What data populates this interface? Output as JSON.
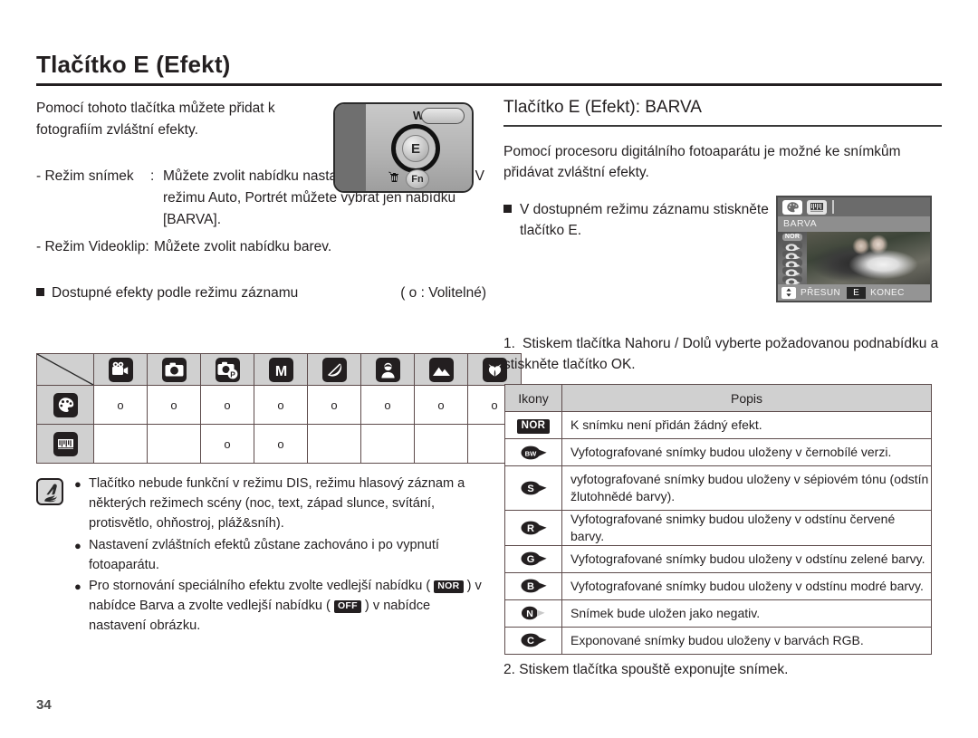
{
  "page": {
    "number": "34",
    "main_title": "Tlačítko E (Efekt)"
  },
  "left": {
    "lead": "Pomocí tohoto tlačítka můžete přidat k fotografiím zvláštní efekty.",
    "modes": [
      {
        "label": "- Režim snímek",
        "colon": ":",
        "desc": "Můžete zvolit nabídku nastavení barvy a obrázku. V režimu Auto, Portrét můžete vybrat jen nabídku [BARVA]."
      },
      {
        "label": "- Režim Videoklip:",
        "colon": "",
        "desc": "Můžete zvolit nabídku barev."
      }
    ],
    "available_heading": "Dostupné efekty podle režimu záznamu",
    "available_note": "( o : Volitelné)",
    "camera_illustration": {
      "w_label": "W",
      "e_button": "E",
      "fn_button": "Fn",
      "trash_icon": "trash-icon"
    }
  },
  "matrix": {
    "columns": [
      {
        "icon": "movie-clip-icon"
      },
      {
        "icon": "auto-mode-icon"
      },
      {
        "icon": "program-mode-icon"
      },
      {
        "icon": "manual-mode-icon"
      },
      {
        "icon": "scene-mode-icon"
      },
      {
        "icon": "portrait-mode-icon"
      },
      {
        "icon": "landscape-mode-icon"
      },
      {
        "icon": "macro-mode-icon"
      }
    ],
    "rows": [
      {
        "icon": "color-palette-icon",
        "values": [
          "o",
          "o",
          "o",
          "o",
          "o",
          "o",
          "o",
          "o"
        ]
      },
      {
        "icon": "image-adjust-icon",
        "values": [
          "",
          "",
          "o",
          "o",
          "",
          "",
          "",
          ""
        ]
      }
    ]
  },
  "note": {
    "icon": "note-hand-icon",
    "items": [
      {
        "bullet": "●",
        "parts": [
          {
            "type": "text",
            "value": "Tlačítko nebude funkční v režimu DIS, režimu hlasový záznam a některých režimech scény (noc, text, západ slunce, svítání, protisvětlo, ohňostroj, pláž&sníh)."
          }
        ]
      },
      {
        "bullet": "●",
        "parts": [
          {
            "type": "text",
            "value": "Nastavení zvláštních efektů zůstane zachováno i po vypnutí fotoaparátu."
          }
        ]
      },
      {
        "bullet": "●",
        "parts": [
          {
            "type": "text",
            "value": "Pro stornování speciálního efektu zvolte vedlejší nabídku ( "
          },
          {
            "type": "badge",
            "value": "NOR"
          },
          {
            "type": "text",
            "value": " ) v nabídce Barva a zvolte vedlejší nabídku ( "
          },
          {
            "type": "badge",
            "value": "OFF"
          },
          {
            "type": "text",
            "value": " ) v nabídce nastavení obrázku."
          }
        ]
      }
    ]
  },
  "right": {
    "sub_title": "Tlačítko E (Efekt): BARVA",
    "lead": "Pomocí procesoru digitálního fotoaparátu je možné ke snímkům přidávat zvláštní efekty.",
    "bullet": "V dostupném režimu záznamu stiskněte tlačítko E.",
    "step1": {
      "num": "1.",
      "text": "Stiskem tlačítka Nahoru / Dolů vyberte požadovanou podnabídku a stiskněte tlačítko OK."
    },
    "step2": "2. Stiskem tlačítka spouště exponujte snímek."
  },
  "lcd": {
    "tabs": [
      {
        "icon": "color-palette-icon",
        "active": true
      },
      {
        "icon": "image-adjust-icon",
        "active": false
      }
    ],
    "title": "BARVA",
    "menu_items": [
      {
        "icon": "nor-badge",
        "label": "NOR",
        "selected": true
      },
      {
        "icon": "effect-blob-icon",
        "label": "",
        "selected": false
      },
      {
        "icon": "effect-blob-icon",
        "label": "",
        "selected": false
      },
      {
        "icon": "effect-blob-icon",
        "label": "",
        "selected": false
      },
      {
        "icon": "effect-blob-icon",
        "label": "",
        "selected": false
      },
      {
        "icon": "effect-blob-icon",
        "label": "",
        "selected": false
      }
    ],
    "bottom": {
      "arrows_icon": "up-down-arrows-icon",
      "move_label": "PŘESUN",
      "e_key": "E",
      "exit_label": "KONEC"
    }
  },
  "desc_table": {
    "headers": [
      "Ikony",
      "Popis"
    ],
    "rows": [
      {
        "icon": "nor-badge",
        "icon_label": "NOR",
        "desc": "K snímku není přidán žádný efekt.",
        "two_line": false
      },
      {
        "icon": "bw-blob-icon",
        "icon_label": "BW",
        "desc": "Vyfotografované snímky budou uloženy v černobílé verzi.",
        "two_line": false
      },
      {
        "icon": "sepia-blob-icon",
        "icon_label": "S",
        "desc": "vyfotografované snímky budou uloženy v sépiovém tónu (odstín žlutohnědé barvy).",
        "two_line": true
      },
      {
        "icon": "red-blob-icon",
        "icon_label": "R",
        "desc": "Vyfotografované snimky budou uloženy v odstínu červené barvy.",
        "two_line": false
      },
      {
        "icon": "green-blob-icon",
        "icon_label": "G",
        "desc": "Vyfotografované snímky budou uloženy v odstínu zelené barvy.",
        "two_line": false
      },
      {
        "icon": "blue-blob-icon",
        "icon_label": "B",
        "desc": "Vyfotografované snímky budou uloženy v odstínu modré barvy.",
        "two_line": false
      },
      {
        "icon": "negative-blob-icon",
        "icon_label": "N",
        "desc": "Snímek bude uložen jako negativ.",
        "two_line": false
      },
      {
        "icon": "custom-blob-icon",
        "icon_label": "C",
        "desc": "Exponované snímky budou uloženy v barvách RGB.",
        "two_line": false
      }
    ]
  },
  "colors": {
    "ink": "#231f20",
    "rule": "#3a3a3a",
    "table_border": "#5d4b4b",
    "header_fill": "#d0d0d0"
  }
}
